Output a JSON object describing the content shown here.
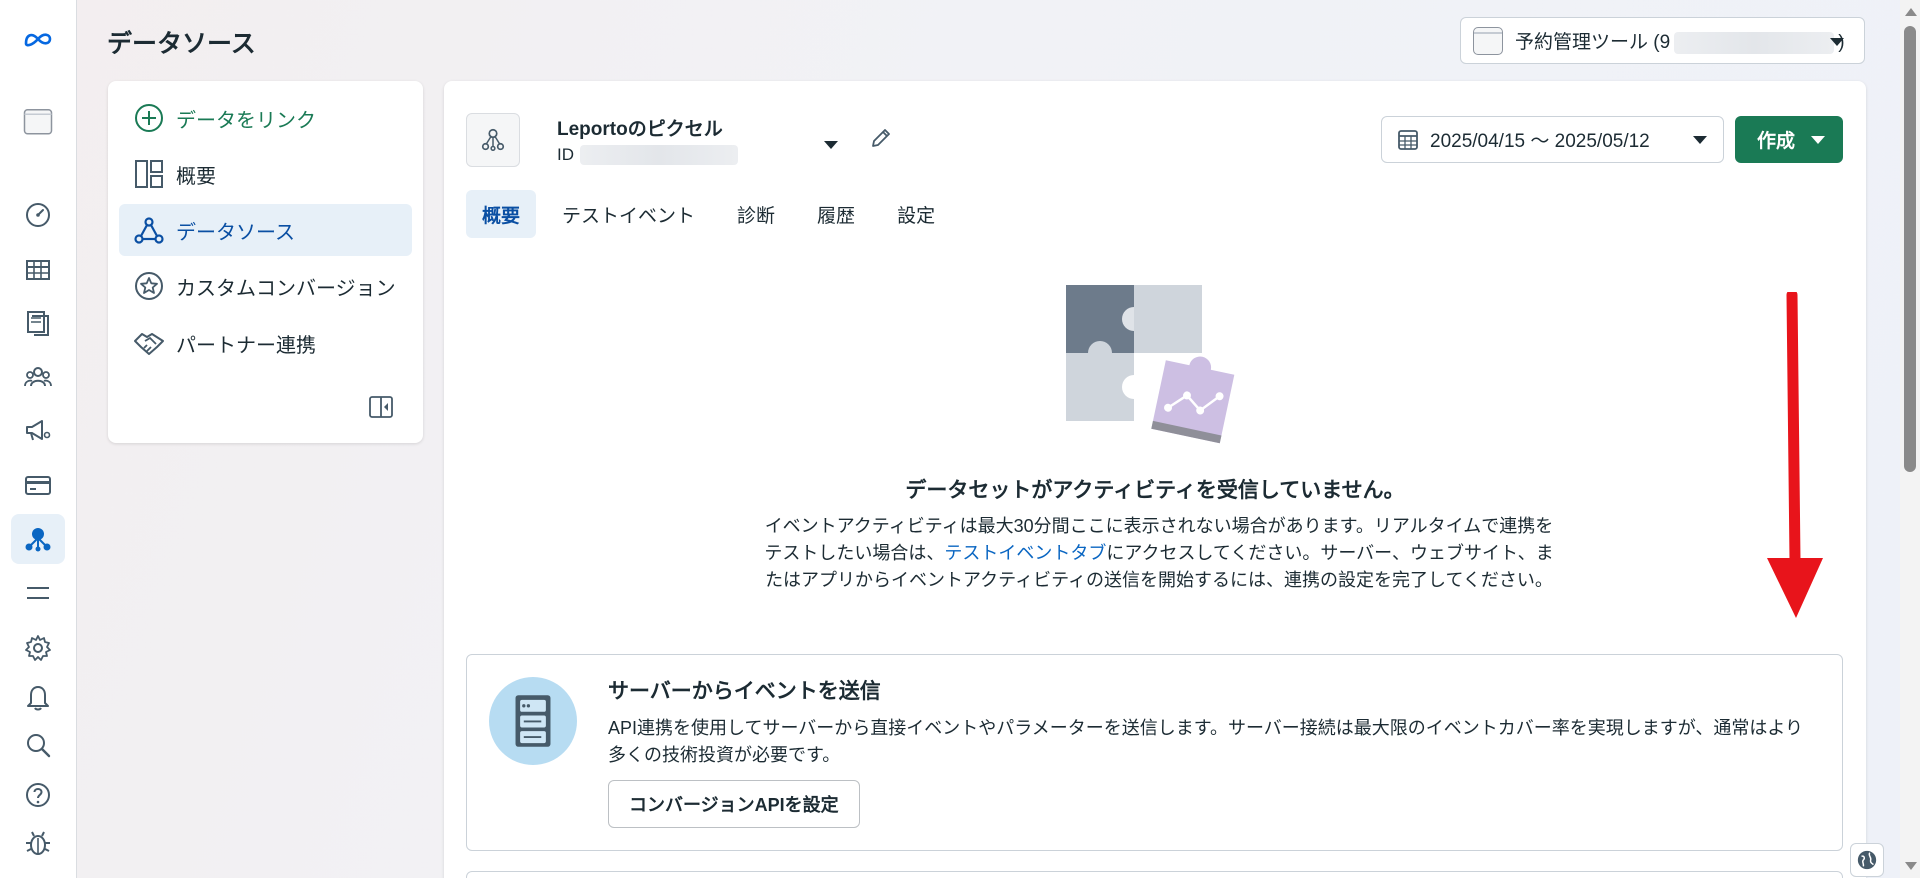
{
  "page": {
    "title": "データソース"
  },
  "account": {
    "name": "予約管理ツール (9",
    "name_suffix": ")"
  },
  "subnav": {
    "items": [
      {
        "label": "データをリンク",
        "icon": "plus-circle-icon"
      },
      {
        "label": "概要",
        "icon": "dashboard-layout-icon"
      },
      {
        "label": "データソース",
        "icon": "data-source-icon",
        "active": true
      },
      {
        "label": "カスタムコンバージョン",
        "icon": "star-badge-icon"
      },
      {
        "label": "パートナー連携",
        "icon": "handshake-icon"
      }
    ]
  },
  "pixel": {
    "name": "Leportoのピクセル",
    "id_label": "ID"
  },
  "date_range": "2025/04/15 ～ 2025/05/12",
  "create_button": "作成",
  "tabs": [
    {
      "label": "概要",
      "active": true
    },
    {
      "label": "テストイベント"
    },
    {
      "label": "診断"
    },
    {
      "label": "履歴"
    },
    {
      "label": "設定"
    }
  ],
  "empty_state": {
    "title": "データセットがアクティビティを受信していません。",
    "desc_before": "イベントアクティビティは最大30分間ここに表示されない場合があります。リアルタイムで連携をテストしたい場合は、",
    "link": "テストイベントタブ",
    "desc_after": "にアクセスしてください。サーバー、ウェブサイト、またはアプリからイベントアクティビティの送信を開始するには、連携の設定を完了してください。"
  },
  "server_card": {
    "title": "サーバーからイベントを送信",
    "desc": "API連携を使用してサーバーから直接イベントやパラメーターを送信します。サーバー接続は最大限のイベントカバー率を実現しますが、通常はより多くの技術投資が必要です。",
    "button": "コンバージョンAPIを設定"
  },
  "colors": {
    "brand_green": "#1a7a55",
    "active_blue": "#0a4fa3",
    "link_blue": "#0a66c2",
    "annotation_red": "#e8141b"
  }
}
